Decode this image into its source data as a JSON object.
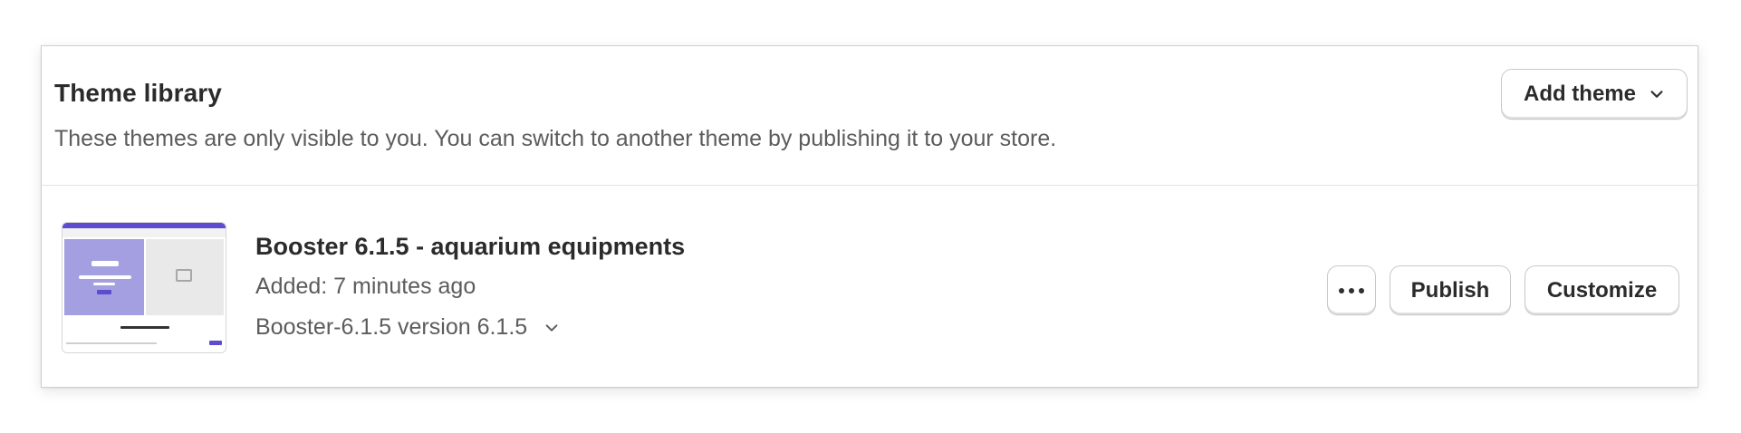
{
  "library": {
    "title": "Theme library",
    "description": "These themes are only visible to you. You can switch to another theme by publishing it to your store.",
    "add_theme_label": "Add theme"
  },
  "theme": {
    "name": "Booster 6.1.5 - aquarium equipments",
    "added": "Added: 7 minutes ago",
    "version": "Booster-6.1.5 version 6.1.5",
    "publish_label": "Publish",
    "customize_label": "Customize",
    "thumbnail_icon": "theme-thumbnail"
  },
  "colors": {
    "accent": "#5e4ccf",
    "hero": "#a39fe0"
  }
}
